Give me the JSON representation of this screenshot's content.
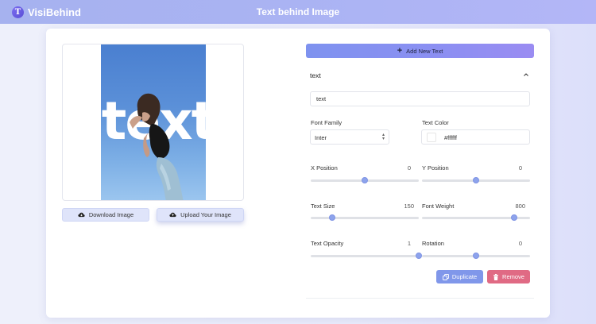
{
  "header": {
    "logo_letter": "T",
    "app_name": "VisiBehind",
    "title": "Text behind Image"
  },
  "preview": {
    "overlay_text": "text",
    "text_color": "#ffffff"
  },
  "actions": {
    "download_label": "Download Image",
    "upload_label": "Upload Your Image"
  },
  "editor": {
    "add_text_label": "Add New Text",
    "section_title": "text",
    "text_value": "text",
    "font_family_label": "Font Family",
    "font_family_value": "Inter",
    "text_color_label": "Text Color",
    "text_color_value": "#ffffff",
    "x_position": {
      "label": "X Position",
      "value": "0",
      "fraction": 0.5
    },
    "y_position": {
      "label": "Y Position",
      "value": "0",
      "fraction": 0.5
    },
    "text_size": {
      "label": "Text Size",
      "value": "150",
      "fraction": 0.2
    },
    "font_weight": {
      "label": "Font Weight",
      "value": "800",
      "fraction": 0.85
    },
    "text_opacity": {
      "label": "Text Opacity",
      "value": "1",
      "fraction": 1.0
    },
    "rotation": {
      "label": "Rotation",
      "value": "0",
      "fraction": 0.5
    },
    "duplicate_label": "Duplicate",
    "remove_label": "Remove"
  },
  "colors": {
    "accent": "#8a93f0",
    "remove": "#e06a84",
    "duplicate": "#8097ea"
  }
}
